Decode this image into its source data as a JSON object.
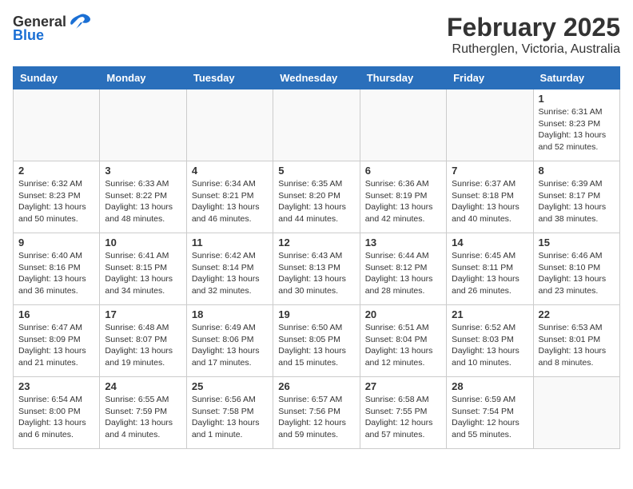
{
  "header": {
    "logo": {
      "general": "General",
      "blue": "Blue"
    },
    "title": "February 2025",
    "subtitle": "Rutherglen, Victoria, Australia"
  },
  "calendar": {
    "days_of_week": [
      "Sunday",
      "Monday",
      "Tuesday",
      "Wednesday",
      "Thursday",
      "Friday",
      "Saturday"
    ],
    "weeks": [
      [
        {
          "day": "",
          "info": ""
        },
        {
          "day": "",
          "info": ""
        },
        {
          "day": "",
          "info": ""
        },
        {
          "day": "",
          "info": ""
        },
        {
          "day": "",
          "info": ""
        },
        {
          "day": "",
          "info": ""
        },
        {
          "day": "1",
          "info": "Sunrise: 6:31 AM\nSunset: 8:23 PM\nDaylight: 13 hours\nand 52 minutes."
        }
      ],
      [
        {
          "day": "2",
          "info": "Sunrise: 6:32 AM\nSunset: 8:23 PM\nDaylight: 13 hours\nand 50 minutes."
        },
        {
          "day": "3",
          "info": "Sunrise: 6:33 AM\nSunset: 8:22 PM\nDaylight: 13 hours\nand 48 minutes."
        },
        {
          "day": "4",
          "info": "Sunrise: 6:34 AM\nSunset: 8:21 PM\nDaylight: 13 hours\nand 46 minutes."
        },
        {
          "day": "5",
          "info": "Sunrise: 6:35 AM\nSunset: 8:20 PM\nDaylight: 13 hours\nand 44 minutes."
        },
        {
          "day": "6",
          "info": "Sunrise: 6:36 AM\nSunset: 8:19 PM\nDaylight: 13 hours\nand 42 minutes."
        },
        {
          "day": "7",
          "info": "Sunrise: 6:37 AM\nSunset: 8:18 PM\nDaylight: 13 hours\nand 40 minutes."
        },
        {
          "day": "8",
          "info": "Sunrise: 6:39 AM\nSunset: 8:17 PM\nDaylight: 13 hours\nand 38 minutes."
        }
      ],
      [
        {
          "day": "9",
          "info": "Sunrise: 6:40 AM\nSunset: 8:16 PM\nDaylight: 13 hours\nand 36 minutes."
        },
        {
          "day": "10",
          "info": "Sunrise: 6:41 AM\nSunset: 8:15 PM\nDaylight: 13 hours\nand 34 minutes."
        },
        {
          "day": "11",
          "info": "Sunrise: 6:42 AM\nSunset: 8:14 PM\nDaylight: 13 hours\nand 32 minutes."
        },
        {
          "day": "12",
          "info": "Sunrise: 6:43 AM\nSunset: 8:13 PM\nDaylight: 13 hours\nand 30 minutes."
        },
        {
          "day": "13",
          "info": "Sunrise: 6:44 AM\nSunset: 8:12 PM\nDaylight: 13 hours\nand 28 minutes."
        },
        {
          "day": "14",
          "info": "Sunrise: 6:45 AM\nSunset: 8:11 PM\nDaylight: 13 hours\nand 26 minutes."
        },
        {
          "day": "15",
          "info": "Sunrise: 6:46 AM\nSunset: 8:10 PM\nDaylight: 13 hours\nand 23 minutes."
        }
      ],
      [
        {
          "day": "16",
          "info": "Sunrise: 6:47 AM\nSunset: 8:09 PM\nDaylight: 13 hours\nand 21 minutes."
        },
        {
          "day": "17",
          "info": "Sunrise: 6:48 AM\nSunset: 8:07 PM\nDaylight: 13 hours\nand 19 minutes."
        },
        {
          "day": "18",
          "info": "Sunrise: 6:49 AM\nSunset: 8:06 PM\nDaylight: 13 hours\nand 17 minutes."
        },
        {
          "day": "19",
          "info": "Sunrise: 6:50 AM\nSunset: 8:05 PM\nDaylight: 13 hours\nand 15 minutes."
        },
        {
          "day": "20",
          "info": "Sunrise: 6:51 AM\nSunset: 8:04 PM\nDaylight: 13 hours\nand 12 minutes."
        },
        {
          "day": "21",
          "info": "Sunrise: 6:52 AM\nSunset: 8:03 PM\nDaylight: 13 hours\nand 10 minutes."
        },
        {
          "day": "22",
          "info": "Sunrise: 6:53 AM\nSunset: 8:01 PM\nDaylight: 13 hours\nand 8 minutes."
        }
      ],
      [
        {
          "day": "23",
          "info": "Sunrise: 6:54 AM\nSunset: 8:00 PM\nDaylight: 13 hours\nand 6 minutes."
        },
        {
          "day": "24",
          "info": "Sunrise: 6:55 AM\nSunset: 7:59 PM\nDaylight: 13 hours\nand 4 minutes."
        },
        {
          "day": "25",
          "info": "Sunrise: 6:56 AM\nSunset: 7:58 PM\nDaylight: 13 hours\nand 1 minute."
        },
        {
          "day": "26",
          "info": "Sunrise: 6:57 AM\nSunset: 7:56 PM\nDaylight: 12 hours\nand 59 minutes."
        },
        {
          "day": "27",
          "info": "Sunrise: 6:58 AM\nSunset: 7:55 PM\nDaylight: 12 hours\nand 57 minutes."
        },
        {
          "day": "28",
          "info": "Sunrise: 6:59 AM\nSunset: 7:54 PM\nDaylight: 12 hours\nand 55 minutes."
        },
        {
          "day": "",
          "info": ""
        }
      ]
    ]
  }
}
